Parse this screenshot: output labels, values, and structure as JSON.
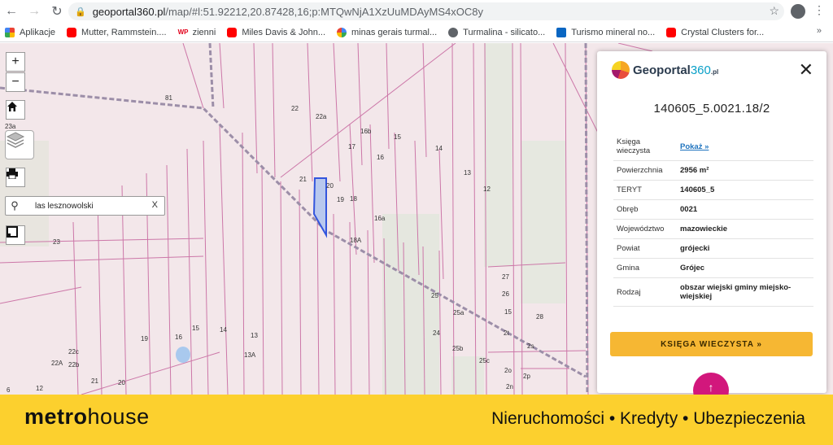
{
  "browser": {
    "url_host": "geoportal360.pl",
    "url_path": "/map/#l:51.92212,20.87428,16;p:MTQwNjA1XzUuMDAyMS4xOC8y",
    "bookmarks": [
      {
        "label": "Aplikacje",
        "icon": "apps-icon"
      },
      {
        "label": "Mutter, Rammstein....",
        "icon": "youtube-icon"
      },
      {
        "label": "zienni",
        "icon": "wp-icon"
      },
      {
        "label": "Miles Davis & John...",
        "icon": "youtube-icon"
      },
      {
        "label": "minas gerais turmal...",
        "icon": "google-icon"
      },
      {
        "label": "Turmalina - silicato...",
        "icon": "globe-icon"
      },
      {
        "label": "Turismo mineral no...",
        "icon": "linkedin-icon"
      },
      {
        "label": "Crystal Clusters for...",
        "icon": "youtube-icon"
      }
    ],
    "more": "»"
  },
  "map": {
    "zoom_in": "+",
    "zoom_out": "−",
    "search_value": "las lesznowolski",
    "search_clear": "X",
    "labels": [
      "81",
      "22",
      "22a",
      "16b",
      "17",
      "15",
      "14",
      "13",
      "16",
      "21",
      "20",
      "19",
      "18",
      "16a",
      "12",
      "18A",
      "23a",
      "23",
      "27",
      "26",
      "25",
      "25a",
      "28",
      "15",
      "2t",
      "24",
      "25b",
      "25c",
      "2s",
      "19",
      "16",
      "15",
      "14",
      "13",
      "13A",
      "22c",
      "22b",
      "22A",
      "21",
      "20",
      "2o",
      "2p",
      "2n",
      "12",
      "6"
    ]
  },
  "panel": {
    "logo_main": "Geoportal",
    "logo_num": "360",
    "logo_tld": ".pl",
    "close": "✕",
    "parcel_id": "140605_5.0021.18/2",
    "rows": [
      {
        "key": "Księga wieczysta",
        "value": "Pokaż »"
      },
      {
        "key": "Powierzchnia",
        "value": "2956 m²"
      },
      {
        "key": "TERYT",
        "value": "140605_5"
      },
      {
        "key": "Obręb",
        "value": "0021"
      },
      {
        "key": "Województwo",
        "value": "mazowieckie"
      },
      {
        "key": "Powiat",
        "value": "grójecki"
      },
      {
        "key": "Gmina",
        "value": "Grójec"
      },
      {
        "key": "Rodzaj",
        "value": "obszar wiejski gminy miejsko-wiejskiej"
      }
    ],
    "kw_button": "KSIĘGA WIECZYSTA »",
    "fab": "↑"
  },
  "banner": {
    "logo_bold": "metro",
    "logo_light": "house",
    "tagline": "Nieruchomości • Kredyty • Ubezpieczenia"
  }
}
